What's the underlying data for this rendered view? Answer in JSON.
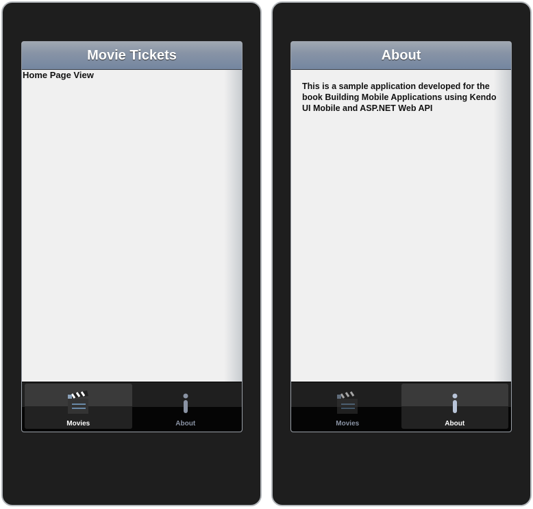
{
  "screens": [
    {
      "title": "Movie Tickets",
      "body": "Home Page View",
      "active_tab": 0
    },
    {
      "title": "About",
      "body": "This is a sample application developed for the book Building Mobile Applications using Kendo UI Mobile and ASP.NET Web API",
      "active_tab": 1
    }
  ],
  "tabs": [
    {
      "label": "Movies",
      "icon": "clapperboard-icon"
    },
    {
      "label": "About",
      "icon": "info-icon"
    }
  ],
  "colors": {
    "header": "#7486a0",
    "frame": "#1e1e1e",
    "content": "#f0f0f0"
  }
}
